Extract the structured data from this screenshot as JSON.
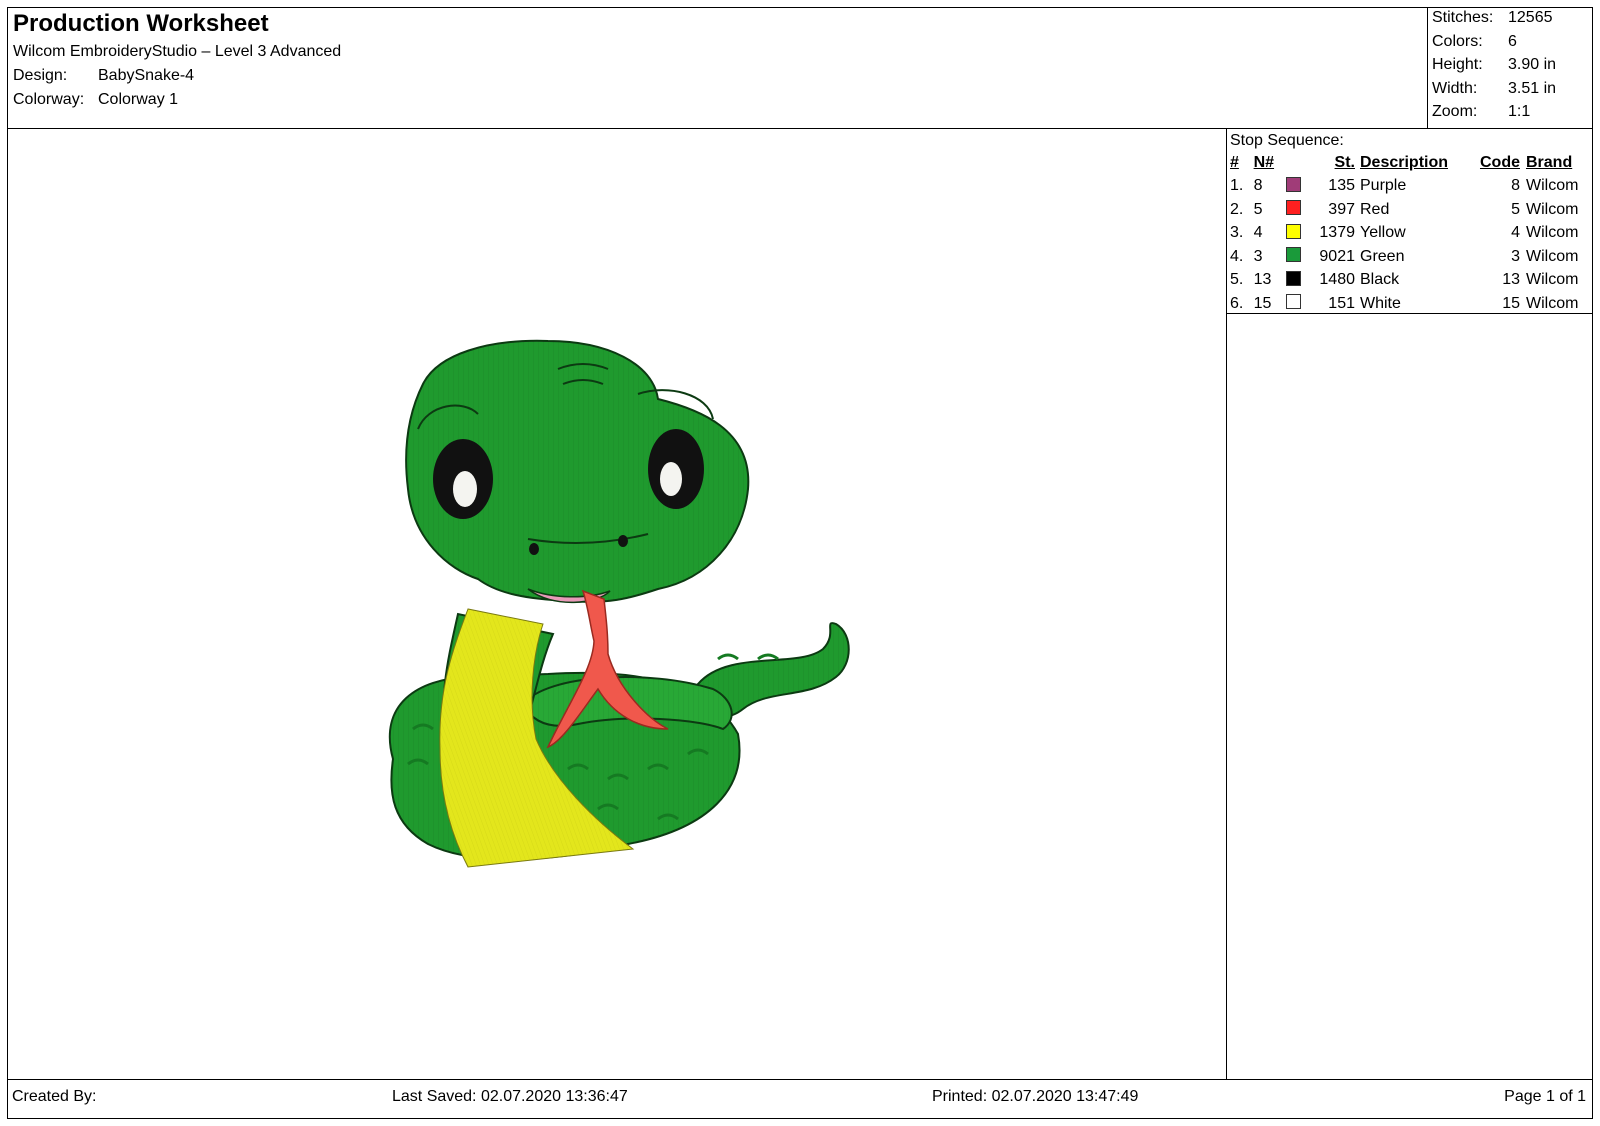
{
  "header": {
    "title": "Production Worksheet",
    "subtitle": "Wilcom EmbroideryStudio – Level 3 Advanced",
    "design_label": "Design:",
    "design_value": "BabySnake-4",
    "colorway_label": "Colorway:",
    "colorway_value": "Colorway 1"
  },
  "stats": {
    "stitches_label": "Stitches:",
    "stitches_value": "12565",
    "colors_label": "Colors:",
    "colors_value": "6",
    "height_label": "Height:",
    "height_value": "3.90 in",
    "width_label": "Width:",
    "width_value": "3.51 in",
    "zoom_label": "Zoom:",
    "zoom_value": "1:1"
  },
  "stop_sequence": {
    "title": "Stop Sequence:",
    "headers": {
      "idx": "#",
      "n": "N#",
      "st": "St.",
      "desc": "Description",
      "code": "Code",
      "brand": "Brand"
    },
    "rows": [
      {
        "idx": "1.",
        "n": "8",
        "color": "#a03c78",
        "st": "135",
        "desc": "Purple",
        "code": "8",
        "brand": "Wilcom"
      },
      {
        "idx": "2.",
        "n": "5",
        "color": "#ff2020",
        "st": "397",
        "desc": "Red",
        "code": "5",
        "brand": "Wilcom"
      },
      {
        "idx": "3.",
        "n": "4",
        "color": "#ffff00",
        "st": "1379",
        "desc": "Yellow",
        "code": "4",
        "brand": "Wilcom"
      },
      {
        "idx": "4.",
        "n": "3",
        "color": "#1a9a3a",
        "st": "9021",
        "desc": "Green",
        "code": "3",
        "brand": "Wilcom"
      },
      {
        "idx": "5.",
        "n": "13",
        "color": "#000000",
        "st": "1480",
        "desc": "Black",
        "code": "13",
        "brand": "Wilcom"
      },
      {
        "idx": "6.",
        "n": "15",
        "color": "#ffffff",
        "st": "151",
        "desc": "White",
        "code": "15",
        "brand": "Wilcom"
      }
    ]
  },
  "footer": {
    "created_by": "Created By:",
    "last_saved": "Last Saved: 02.07.2020 13:36:47",
    "printed": "Printed: 02.07.2020 13:47:49",
    "page": "Page 1 of 1"
  },
  "colors": {
    "green": "#1f9a2e",
    "green_dark": "#157a22",
    "yellow": "#e3e61c",
    "red": "#f0584c",
    "pink": "#e89ab8",
    "black": "#111111",
    "white": "#f4f4f0"
  }
}
